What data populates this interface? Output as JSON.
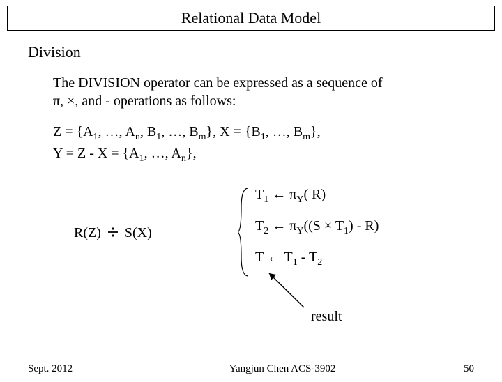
{
  "title": "Relational Data Model",
  "section": "Division",
  "intro_l1": "The DIVISION operator can be expressed as a sequence of",
  "intro_l2_pre": "π, ×, and - operations as follows:",
  "sets": {
    "Z_def_pre": "Z = {A",
    "Z_def_mid": ", …, A",
    "Z_def_mid2": ", B",
    "Z_def_mid3": ", …, B",
    "Z_def_post": "}, X = {B",
    "Z_def_mid4": ", …, B",
    "Z_def_end": "},",
    "Y_def_pre": "Y = Z - X = {A",
    "Y_def_mid": ", …, A",
    "Y_def_end": "},",
    "sub1": "1",
    "subn": "n",
    "subm": "m"
  },
  "lhs": {
    "left": "R(Z)",
    "right": "S(X)"
  },
  "steps": {
    "t1_pre": "T",
    "t1_sub": "1",
    "t1_post": " ← π",
    "t1_ysub": "Y",
    "t1_end": "( R)",
    "t2_pre": "T",
    "t2_sub": "2",
    "t2_post": " ← π",
    "t2_ysub": "Y",
    "t2_mid": "((S × T",
    "t2_sub1": "1",
    "t2_end": ") - R)",
    "t3_pre": "T ",
    "t3_post": " ← T",
    "t3_sub1": "1",
    "t3_mid": " - T",
    "t3_sub2": "2"
  },
  "result_label": "result",
  "footer": {
    "date": "Sept. 2012",
    "center": "Yangjun Chen       ACS-3902",
    "page": "50"
  }
}
